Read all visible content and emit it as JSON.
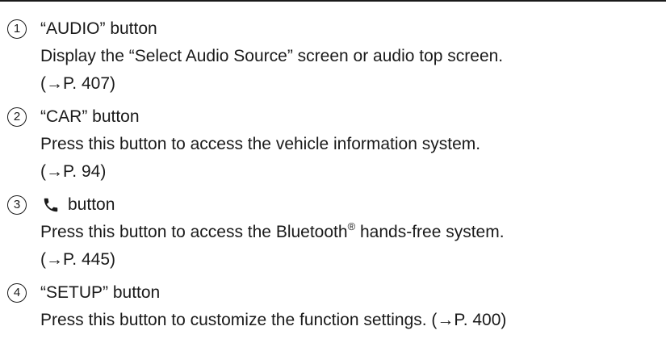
{
  "items": [
    {
      "number": "1",
      "title": "“AUDIO” button",
      "desc": "Display the “Select Audio Source” screen or audio top screen.",
      "ref": "(→P. 407)"
    },
    {
      "number": "2",
      "title": "“CAR” button",
      "desc": "Press this button to access the vehicle information system.",
      "ref": "(→P. 94)"
    },
    {
      "number": "3",
      "icon": "phone-handset-icon",
      "title_suffix": "button",
      "desc_before": "Press this button to access the Bluetooth",
      "desc_mark": "®",
      "desc_after": " hands-free system.",
      "ref": "(→P. 445)"
    },
    {
      "number": "4",
      "title": "“SETUP” button",
      "desc": "Press this button to customize the function settings. (→P. 400)"
    }
  ]
}
